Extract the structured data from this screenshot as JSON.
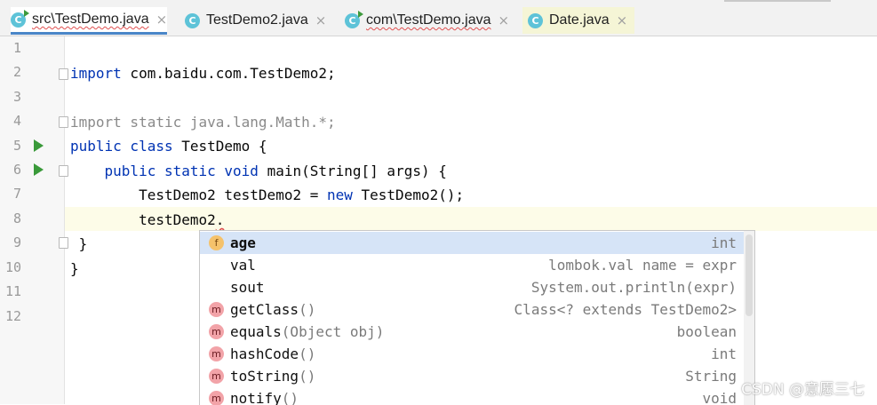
{
  "tabs": [
    {
      "label": "src\\TestDemo.java",
      "icon": "java-class-runnable-icon",
      "active": true
    },
    {
      "label": "TestDemo2.java",
      "icon": "java-class-icon",
      "active": false
    },
    {
      "label": "com\\TestDemo.java",
      "icon": "java-class-runnable-icon",
      "active": false
    },
    {
      "label": "Date.java",
      "icon": "java-class-icon",
      "active": false
    }
  ],
  "close_glyph": "×",
  "line_numbers": [
    "1",
    "2",
    "3",
    "4",
    "5",
    "6",
    "7",
    "8",
    "9",
    "10",
    "11",
    "12"
  ],
  "code": {
    "l2": {
      "kw": "import",
      "rest": " com.baidu.com.TestDemo2;"
    },
    "l4": "import static java.lang.Math.*;",
    "l5": {
      "kw1": "public",
      "kw2": " class",
      "rest": " TestDemo {"
    },
    "l6": {
      "indent": "    ",
      "kw1": "public",
      "kw2": " static",
      "kw3": " void",
      "rest": " main(String[] args) {"
    },
    "l7": {
      "pre": "        TestDemo2 testDemo2 = ",
      "kw": "new",
      "rest": " TestDemo2();"
    },
    "l8": {
      "pre": "        testDemo2",
      "dot": "."
    },
    "l9": " }",
    "l10": "}"
  },
  "completion": [
    {
      "icon": "f",
      "name": "age",
      "params": "",
      "type": "int",
      "selected": true
    },
    {
      "icon": "",
      "name": "val",
      "params": "",
      "type": "lombok.val name = expr",
      "selected": false
    },
    {
      "icon": "",
      "name": "sout",
      "params": "",
      "type": "System.out.println(expr)",
      "selected": false
    },
    {
      "icon": "m",
      "name": "getClass",
      "params": "()",
      "type": "Class<? extends TestDemo2>",
      "selected": false
    },
    {
      "icon": "m",
      "name": "equals",
      "params": "(Object obj)",
      "type": "boolean",
      "selected": false
    },
    {
      "icon": "m",
      "name": "hashCode",
      "params": "()",
      "type": "int",
      "selected": false
    },
    {
      "icon": "m",
      "name": "toString",
      "params": "()",
      "type": "String",
      "selected": false
    },
    {
      "icon": "m",
      "name": "notify",
      "params": "()",
      "type": "void",
      "selected": false
    }
  ],
  "watermark": "CSDN @意愿三七",
  "colors": {
    "keyword": "#0033b3",
    "field_icon": "#f5c26b",
    "method_icon": "#f2a3a8",
    "class_icon": "#5ec3d8",
    "run": "#3a9a3a"
  }
}
